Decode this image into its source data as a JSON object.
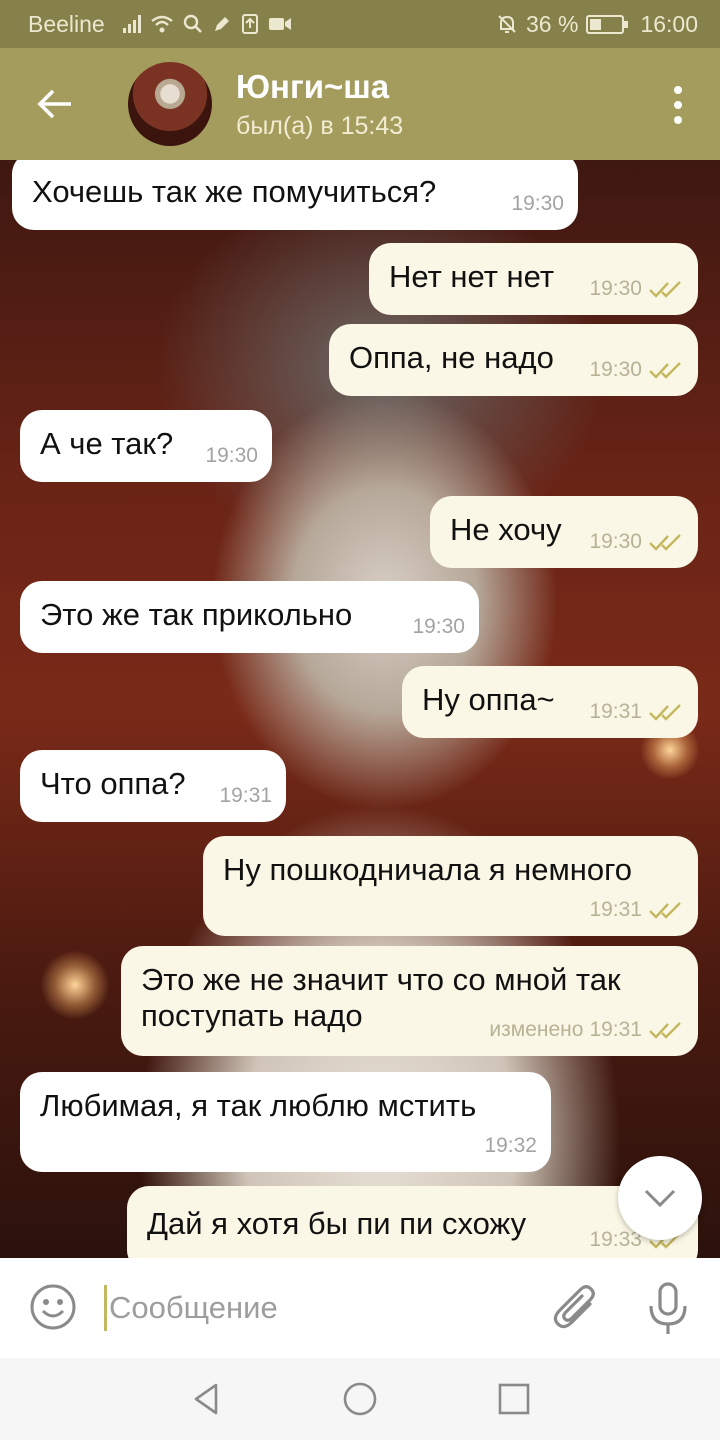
{
  "status_bar": {
    "carrier": "Beeline",
    "battery": "36 %",
    "battery_level": 0.36,
    "time": "16:00"
  },
  "header": {
    "contact_name": "Юнги~ша",
    "last_seen": "был(а) в 15:43"
  },
  "messages": [
    {
      "direction": "in",
      "text": "Хочешь так же помучиться?",
      "time": "19:30"
    },
    {
      "direction": "out",
      "text": "Нет нет нет",
      "time": "19:30",
      "read": true
    },
    {
      "direction": "out",
      "text": "Оппа, не надо",
      "time": "19:30",
      "read": true
    },
    {
      "direction": "in",
      "text": "А че так?",
      "time": "19:30"
    },
    {
      "direction": "out",
      "text": "Не хочу",
      "time": "19:30",
      "read": true
    },
    {
      "direction": "in",
      "text": "Это же так прикольно",
      "time": "19:30"
    },
    {
      "direction": "out",
      "text": "Ну оппа~",
      "time": "19:31",
      "read": true
    },
    {
      "direction": "in",
      "text": "Что оппа?",
      "time": "19:31"
    },
    {
      "direction": "out",
      "text": "Ну пошкодничала я немного",
      "time": "19:31",
      "read": true
    },
    {
      "direction": "out",
      "text_line1": "Это же не значит что со мной так",
      "text_line2": "поступать надо",
      "edited_label": "изменено",
      "time": "19:31",
      "read": true
    },
    {
      "direction": "in",
      "text": "Любимая, я так люблю мстить",
      "time": "19:32"
    },
    {
      "direction": "out",
      "text": "Дай я хотя бы пи пи схожу",
      "time": "19:33",
      "read": true
    }
  ],
  "input": {
    "placeholder": "Сообщение"
  },
  "icons": {
    "back": "arrow-left-icon",
    "menu": "more-vertical-icon",
    "emoji": "smile-icon",
    "attach": "paperclip-icon",
    "mic": "microphone-icon",
    "scroll": "chevron-down-icon"
  },
  "colors": {
    "header": "#a49c5d",
    "status_bar": "#86804a",
    "incoming_bubble": "#ffffff",
    "outgoing_bubble": "#fbf7e6",
    "read_ticks": "#c4b85e"
  }
}
